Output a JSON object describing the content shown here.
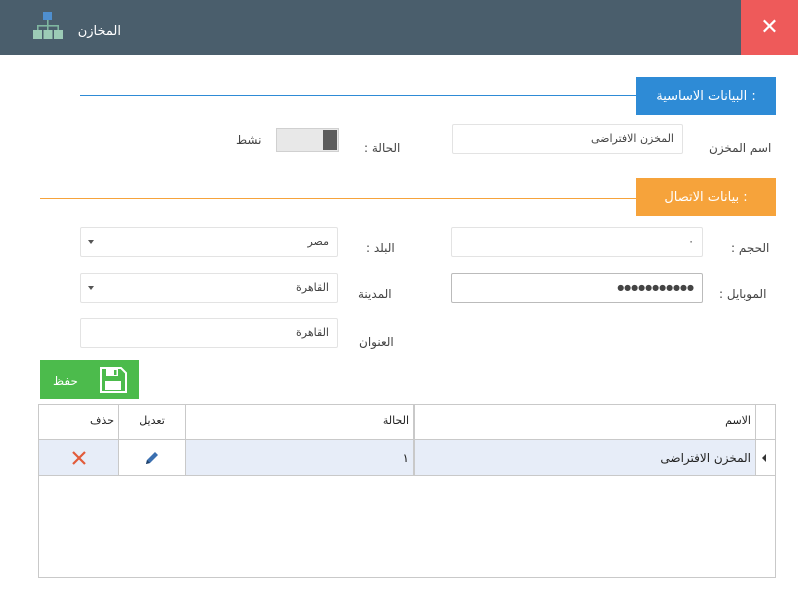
{
  "window": {
    "title": "المخازن",
    "icon": "sitemap-icon",
    "close_glyph": "✕"
  },
  "colors": {
    "titlebar": "#4a5e6c",
    "close": "#ee5a5a",
    "section_basic": "#2e8bd6",
    "section_contact": "#f6a33b",
    "save": "#4cbb4c",
    "selected_row": "#e7edf8"
  },
  "sections": {
    "basic_title": "البيانات الاساسية :",
    "contact_title": "بيانات الاتصال :"
  },
  "form": {
    "store_name_label": "اسم المخزن",
    "store_name_value": "المخزن الافتراضى",
    "status_label": "الحالة :",
    "status_toggle_text": "نشط",
    "volume_label": "الحجم :",
    "volume_value": "٠",
    "country_label": "البلد :",
    "country_value": "مصر",
    "mobile_label": "الموبايل :",
    "mobile_value": "●●●●●●●●●●●",
    "city_label": "المدينة",
    "city_value": "القاهرة",
    "address_label": "العنوان",
    "address_value": "القاهرة"
  },
  "actions": {
    "save_label": "حفظ",
    "save_icon": "floppy-disk-icon"
  },
  "grid": {
    "columns": {
      "name": "الاسم",
      "status": "الحالة",
      "edit": "تعديل",
      "delete": "حذف"
    },
    "rows": [
      {
        "name": "المخزن الافتراضى",
        "status": "١",
        "edit_icon": "pencil-icon",
        "delete_icon": "close-icon"
      }
    ]
  }
}
